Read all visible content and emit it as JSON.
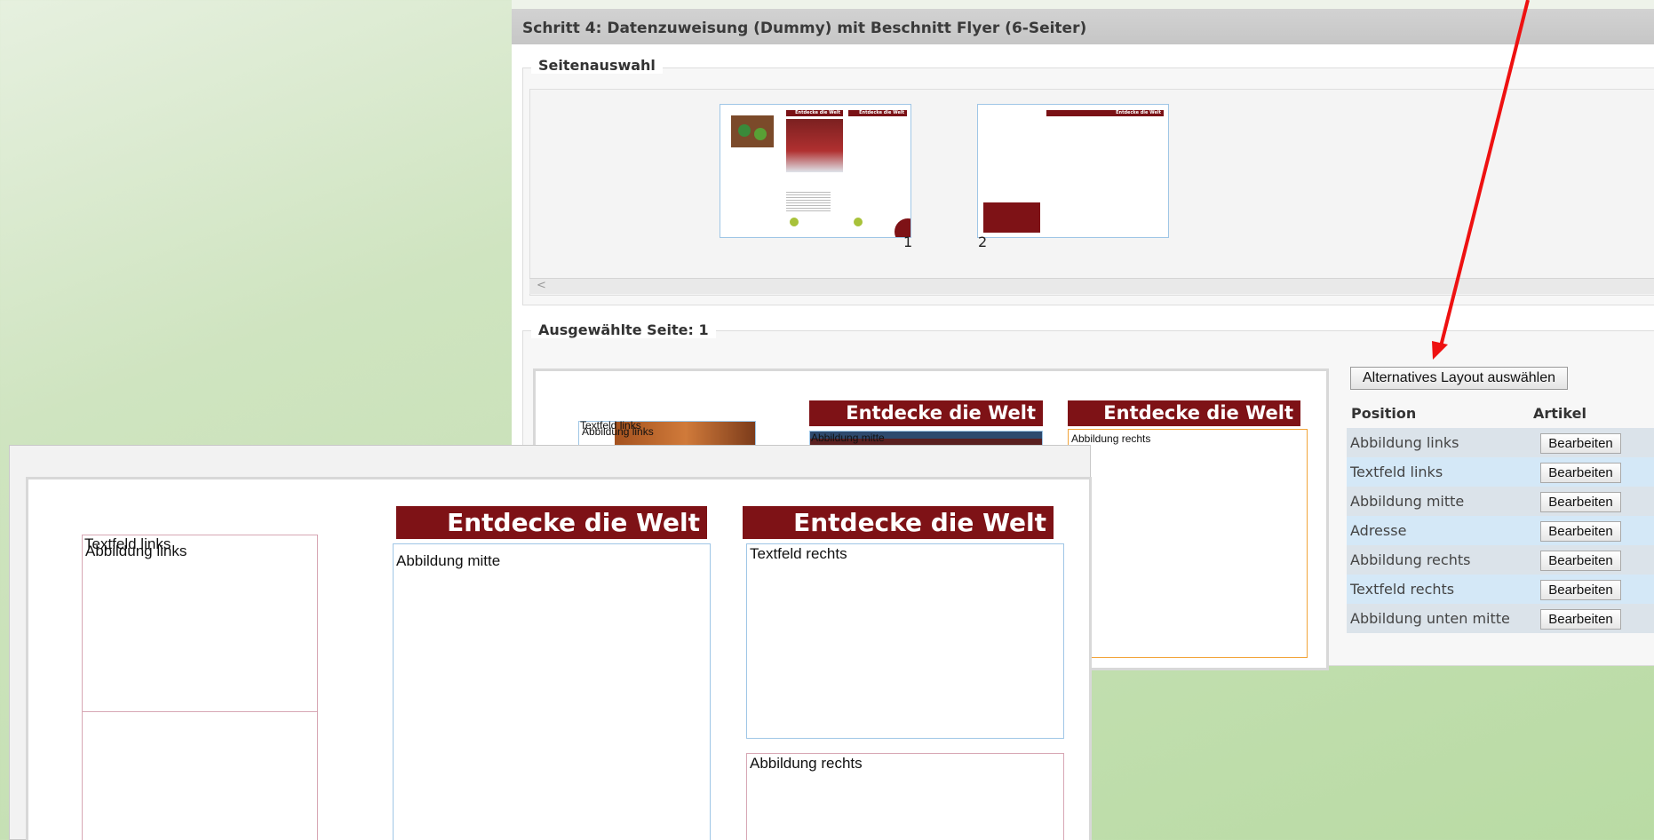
{
  "step": {
    "title": "Schritt 4:  Datenzuweisung (Dummy) mit Beschnitt Flyer (6-Seiter)"
  },
  "seitenauswahl": {
    "legend": "Seitenauswahl",
    "pages": [
      {
        "number": "1",
        "banner_left": "Entdecke die Welt",
        "banner_right": "Entdecke die Welt"
      },
      {
        "number": "2",
        "banner": "Entdecke die Welt"
      }
    ],
    "scroll_arrow": "<"
  },
  "ausgewaehlt": {
    "legend": "Ausgewählte Seite: 1",
    "preview": {
      "label_textfeld_links": "Textfeld links",
      "label_abbildung_links": "Abbildung links",
      "banner_mid": "Entdecke die Welt",
      "banner_right": "Entdecke die Welt",
      "label_abbildung_mitte": "Abbildung mitte",
      "label_abbildung_rechts": "Abbildung rechts"
    },
    "alt_layout_button": "Alternatives Layout auswählen",
    "table": {
      "headers": {
        "position": "Position",
        "artikel": "Artikel"
      },
      "rows": [
        {
          "position": "Abbildung links",
          "action": "Bearbeiten"
        },
        {
          "position": "Textfeld links",
          "action": "Bearbeiten"
        },
        {
          "position": "Abbildung mitte",
          "action": "Bearbeiten"
        },
        {
          "position": "Adresse",
          "action": "Bearbeiten"
        },
        {
          "position": "Abbildung rechts",
          "action": "Bearbeiten"
        },
        {
          "position": "Textfeld rechts",
          "action": "Bearbeiten"
        },
        {
          "position": "Abbildung unten mitte",
          "action": "Bearbeiten"
        }
      ]
    }
  },
  "zoom": {
    "label_textfeld_links": "Textfeld links",
    "label_abbildung_links": "Abbildung links",
    "banner_mid": "Entdecke die Welt",
    "banner_right": "Entdecke die Welt",
    "label_abbildung_mitte": "Abbildung mitte",
    "label_textfeld_rechts": "Textfeld rechts",
    "label_abbildung_rechts": "Abbildung rechts"
  },
  "colors": {
    "banner": "#7e1216",
    "row_even": "#dbe3ea",
    "row_odd": "#d4e8f7",
    "arrow": "#ee1111"
  }
}
